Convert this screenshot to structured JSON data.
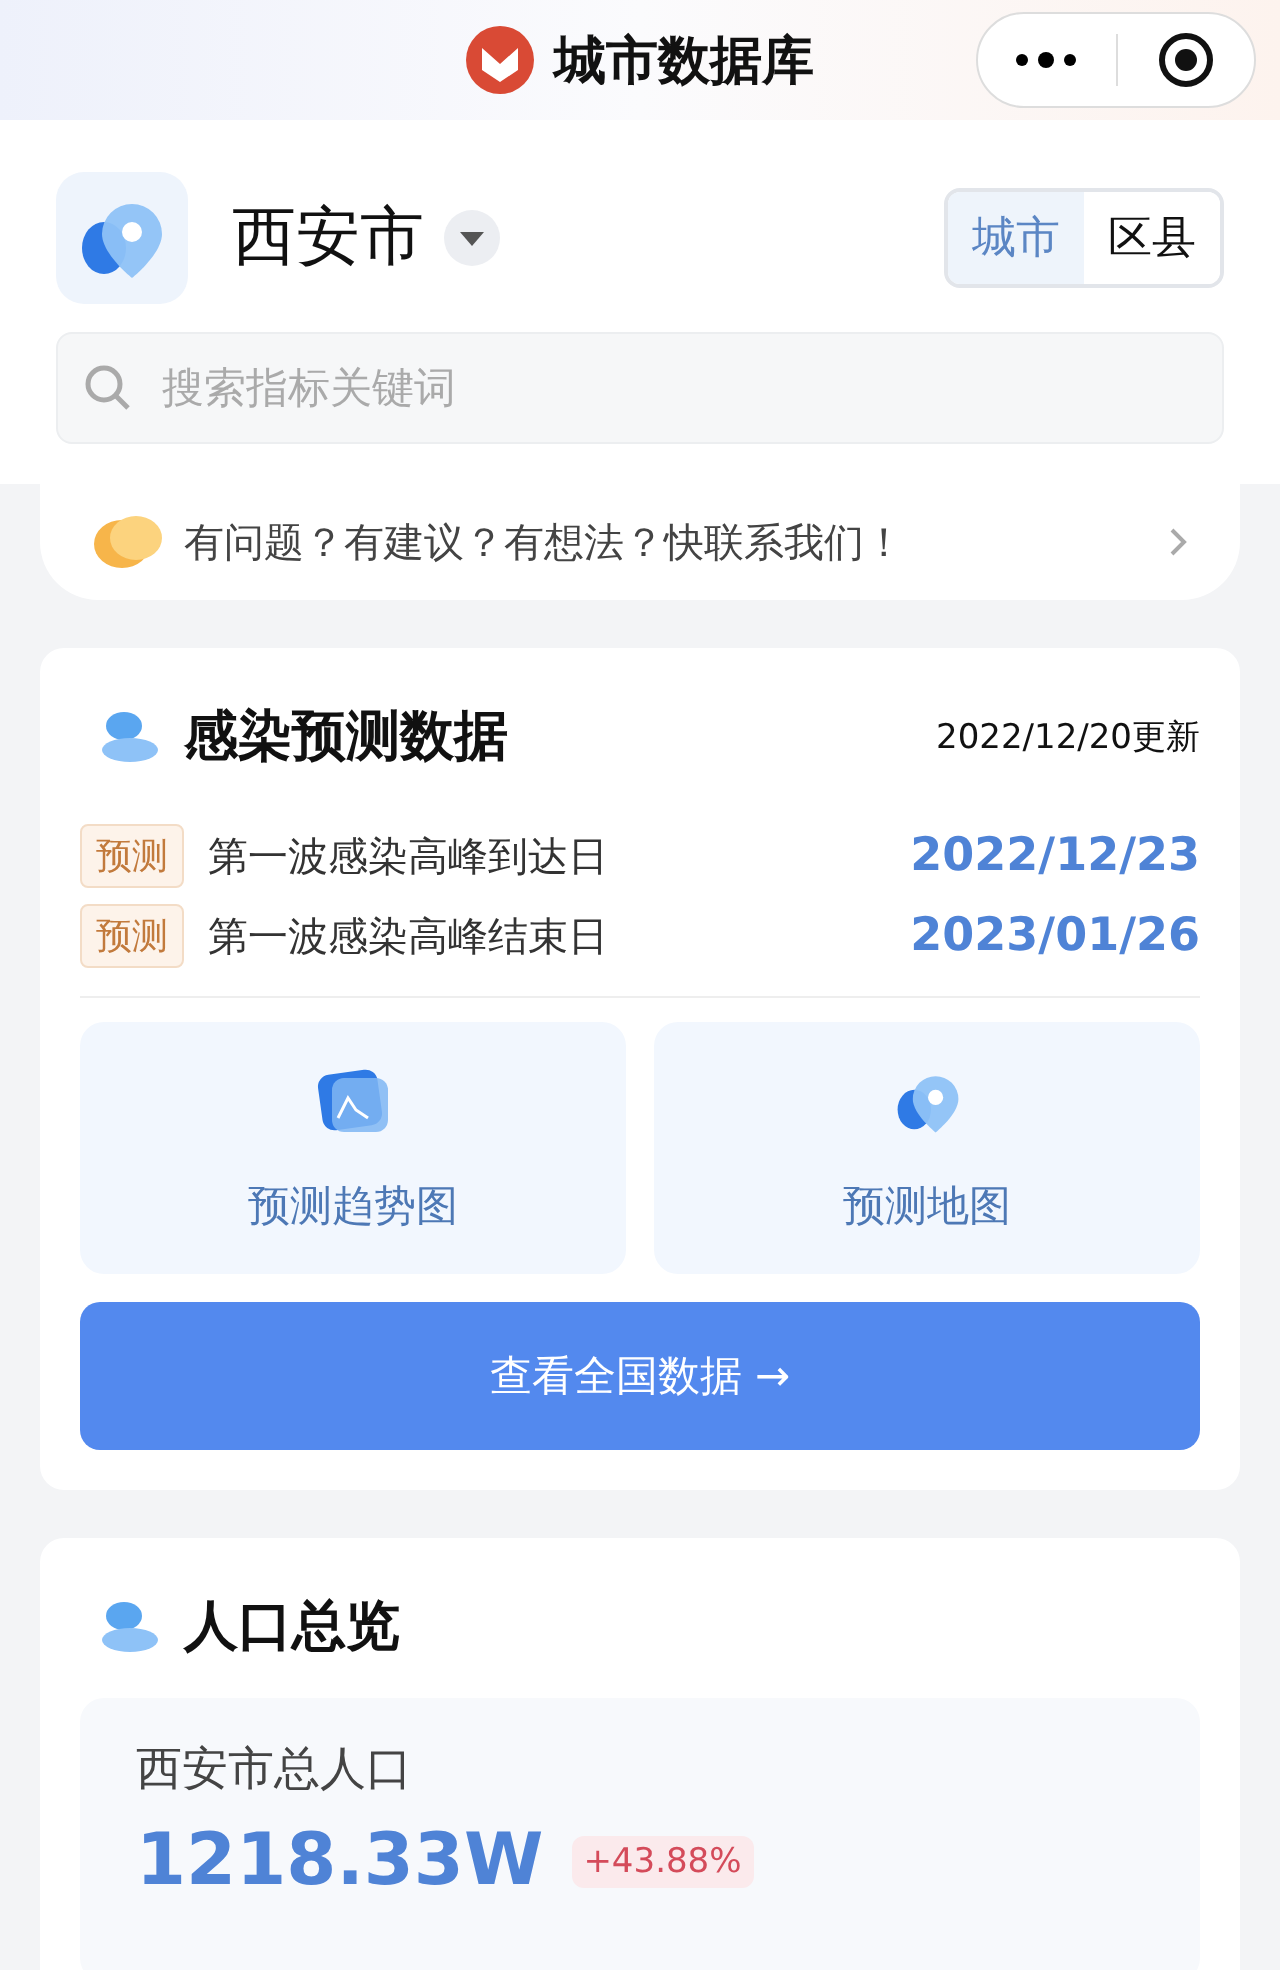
{
  "nav": {
    "title": "城市数据库"
  },
  "city": {
    "name": "西安市"
  },
  "scope_tabs": [
    {
      "label": "城市",
      "selected": true
    },
    {
      "label": "区县",
      "selected": false
    }
  ],
  "search": {
    "placeholder": "搜索指标关键词"
  },
  "feedback": {
    "text": "有问题？有建议？有想法？快联系我们！"
  },
  "infection_card": {
    "title": "感染预测数据",
    "updated": "2022/12/20更新",
    "rows": [
      {
        "tag": "预测",
        "label": "第一波感染高峰到达日",
        "date": "2022/12/23"
      },
      {
        "tag": "预测",
        "label": "第一波感染高峰结束日",
        "date": "2023/01/26"
      }
    ],
    "tiles": [
      {
        "kind": "trend",
        "label": "预测趋势图"
      },
      {
        "kind": "map",
        "label": "预测地图"
      }
    ],
    "button": {
      "label": "查看全国数据 →"
    }
  },
  "population_card": {
    "title": "人口总览",
    "stat": {
      "label": "西安市总人口",
      "value": "1218.33W",
      "change": "+43.88%"
    }
  }
}
